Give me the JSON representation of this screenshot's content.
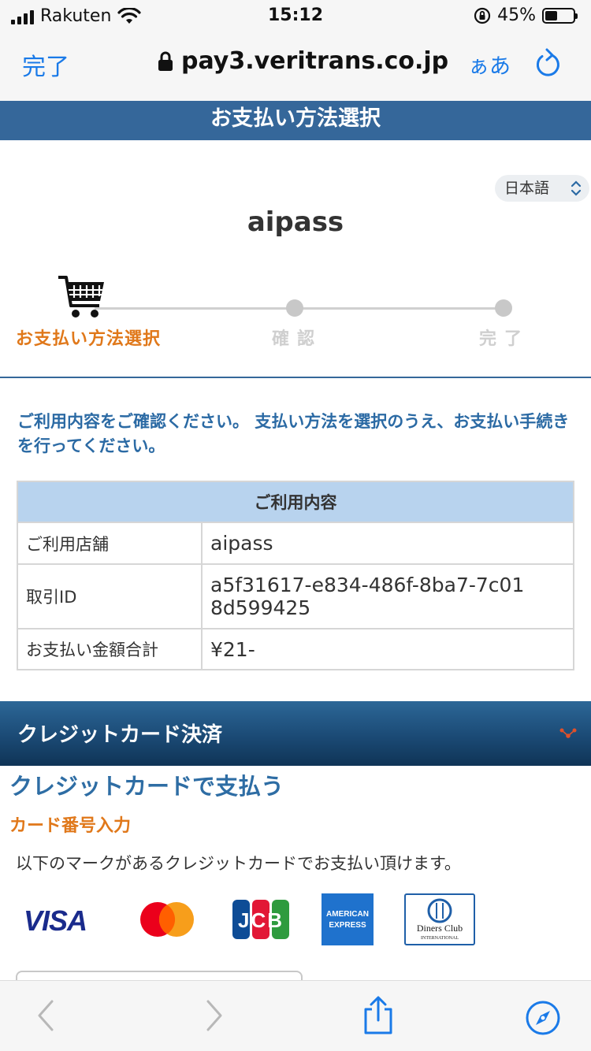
{
  "status": {
    "carrier": "Rakuten",
    "time": "15:12",
    "battery": "45%",
    "battery_level": 0.45
  },
  "browser": {
    "done_label": "完了",
    "url": "pay3.veritrans.co.jp",
    "text_size_label": "ぁあ"
  },
  "page": {
    "header": "お支払い方法選択",
    "language": "日本語",
    "shop_name": "aipass"
  },
  "steps": [
    {
      "label": "お支払い方法選択",
      "active": true
    },
    {
      "label": "確認",
      "active": false
    },
    {
      "label": "完了",
      "active": false
    }
  ],
  "intro": "ご利用内容をご確認ください。 支払い方法を選択のうえ、お支払い手続きを行ってください。",
  "usage_table": {
    "title": "ご利用内容",
    "rows": [
      {
        "key": "ご利用店舗",
        "value": "aipass"
      },
      {
        "key": "取引ID",
        "value": "a5f31617-e834-486f-8ba7-7c018d599425"
      },
      {
        "key": "お支払い金額合計",
        "value": "¥21-"
      }
    ]
  },
  "credit": {
    "section_title": "クレジットカード決済",
    "heading": "クレジットカードで支払う",
    "card_input_label": "カード番号入力",
    "note": "以下のマークがあるクレジットカードでお支払い頂けます。",
    "brands": {
      "visa": "VISA",
      "jcb": "JCB",
      "amex_line1": "AMERICAN",
      "amex_line2": "EXPRESS",
      "diners_line1": "Diners Club",
      "diners_line2": "INTERNATIONAL"
    }
  },
  "colors": {
    "accent": "#1a7ae8",
    "header_blue": "#35679a",
    "step_orange": "#e0781a"
  }
}
